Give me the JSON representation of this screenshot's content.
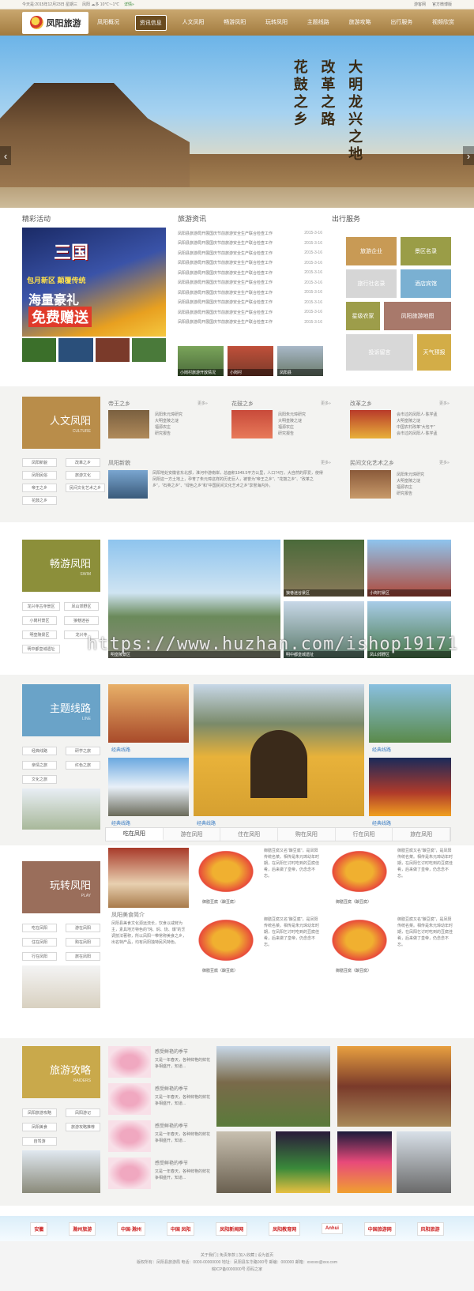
{
  "topbar": {
    "date": "今天是:2015年12月23日 星期三",
    "weather": "凤阳 ☁多 10℃~-1℃",
    "detail": "详情»",
    "links": [
      "游客网",
      "官方微博版"
    ]
  },
  "brand": {
    "logo_text": "凤阳旅游"
  },
  "nav": [
    "凤阳概况",
    "资讯信息",
    "人文凤阳",
    "畅游凤阳",
    "玩转凤阳",
    "主题线路",
    "旅游攻略",
    "出行服务",
    "视频欣赏"
  ],
  "banner": {
    "poem": [
      "大明龙兴之地",
      "改革之路",
      "花鼓之乡"
    ]
  },
  "sections": {
    "activities": "精彩活动",
    "news": "旅游资讯",
    "services": "出行服务"
  },
  "promo": {
    "game": "三国",
    "line1": "包月新区 颠覆传统",
    "line2": "海量豪礼",
    "line3": "免费赠送"
  },
  "news": [
    {
      "title": "凤阳县旅游局开展国庆节前旅游安全生产联合检查工作",
      "date": "2015-3-16"
    },
    {
      "title": "凤阳县旅游局开展国庆节前旅游安全生产联合检查工作",
      "date": "2015-3-16"
    },
    {
      "title": "凤阳县旅游局开展国庆节前旅游安全生产联合检查工作",
      "date": "2015-3-16"
    },
    {
      "title": "凤阳县旅游局开展国庆节前旅游安全生产联合检查工作",
      "date": "2015-3-16"
    },
    {
      "title": "凤阳县旅游局开展国庆节前旅游安全生产联合检查工作",
      "date": "2015-3-16"
    },
    {
      "title": "凤阳县旅游局开展国庆节前旅游安全生产联合检查工作",
      "date": "2015-3-16"
    },
    {
      "title": "凤阳县旅游局开展国庆节前旅游安全生产联合检查工作",
      "date": "2015-3-16"
    },
    {
      "title": "凤阳县旅游局开展国庆节前旅游安全生产联合检查工作",
      "date": "2015-3-16"
    },
    {
      "title": "凤阳县旅游局开展国庆节前旅游安全生产联合检查工作",
      "date": "2015-3-16"
    },
    {
      "title": "凤阳县旅游局开展国庆节前旅游安全生产联合检查工作",
      "date": "2015-3-16"
    }
  ],
  "news_thumbs": [
    "小岗村旅游开放情况",
    "小岗村",
    "凤阳县"
  ],
  "services": [
    "旅游企业",
    "景区名录",
    "旅行社名录",
    "酒店宾馆",
    "星级农家",
    "凤阳旅游地图",
    "投诉留言",
    "天气预报"
  ],
  "culture": {
    "tag": "人文凤阳",
    "tag_en": "CULTURE",
    "subs": [
      "凤阳新貌",
      "改革之乡",
      "凤阳民俗",
      "旅游文化",
      "帝王之乡",
      "花鼓之乡",
      "凤阳美食",
      "民间文化艺术之乡",
      "花鼓之乡"
    ],
    "cards": [
      {
        "title": "帝王之乡",
        "lines": [
          "凤阳朱元璋研究",
          "大明皇陵之谜",
          "福源农庄",
          "研究报告"
        ]
      },
      {
        "title": "花鼓之乡",
        "lines": [
          "凤阳朱元璋研究",
          "大明皇陵之谜",
          "福源农庄",
          "研究报告"
        ]
      },
      {
        "title": "改革之乡",
        "lines": [
          "会市过的凤阳人·陈学孟",
          "大明皇陵之谜",
          "中国农村改革\"大包干\"",
          "会市过的凤阳人·陈学孟"
        ]
      }
    ],
    "xm_title": "凤阳新貌",
    "xm_text": "凤阳地处安徽省东北部，淮河中游南岸，总面积1949.5平方公里，人口74万。大自然的厚爱，使得凤阳这一方土地上，孕育了朱元璋这样的历史巨人，被誉为\"帝王之乡\"、\"花鼓之乡\"、\"改革之乡\"，\"石英之乡\"、\"绿色之乡\"和\"中国民间文化艺术之乡\"享誉海内外。",
    "art_title": "民间文化艺术之乡",
    "art_lines": [
      "凤阳朱元璋研究",
      "大明皇陵之谜",
      "福源农庄",
      "研究报告"
    ],
    "more": "更多»"
  },
  "tour": {
    "tag": "畅游凤阳",
    "tag_en": "SWIM",
    "subs": [
      "龙兴寺古寺景区",
      "凤山郊野区",
      "小岗村景区",
      "明皇陵景区",
      "明中都皇城遗址",
      "狼巷迷谷",
      "龙兴寺"
    ],
    "caps": [
      "明皇陵景区",
      "狼巷迷谷景区",
      "小岗村景区",
      "明中都皇城遗址",
      "凤山郊野区"
    ]
  },
  "routes": {
    "tag": "主题线路",
    "tag_en": "LINE",
    "subs": [
      "经典线路",
      "研学之旅",
      "亲情之旅",
      "红色之旅",
      "文化之旅"
    ],
    "caps": [
      "经典线路",
      "经典线路",
      "经典线路",
      "经典线路",
      "经典线路"
    ]
  },
  "play": {
    "tag": "玩转凤阳",
    "tag_en": "PLAY",
    "subs": [
      "吃在凤阳",
      "游在凤阳",
      "住在凤阳",
      "购在凤阳",
      "行在凤阳",
      "旅在凤阳"
    ],
    "tabs": [
      "吃在凤阳",
      "游在凤阳",
      "住在凤阳",
      "购在凤阳",
      "行在凤阳",
      "旅在凤阳"
    ],
    "intro_title": "凤阳美食简介",
    "intro_text": "凤阳县美食文化源远流长，饮食以咸鲜为主，素具地方特色的\"炖、焖、烧、爆\"的烹调技法著称，所以凤阳一带常称美食之乡，出名特产品，均有凤阳独特民风特色。",
    "dish": "御膳豆腐（酿豆腐）",
    "dish_text": "御膳豆腐又名\"酿豆腐\"，是凤阳传统名菜。相传是朱元璋幼年时期，在凤阳乞讨时吃到的豆腐佳肴，后来做了皇帝，仍念念不忘。"
  },
  "guide": {
    "tag": "旅游攻略",
    "tag_en": "RAIDERS",
    "subs": [
      "凤阳旅游攻略",
      "凤阳游记",
      "凤阳美食",
      "旅游攻略推荐",
      "自驾游"
    ],
    "items": [
      {
        "title": "感受鲜艳的季节",
        "text": "又是一年春天，各种鲜艳的鲜花争相盛开，知道..."
      },
      {
        "title": "感受鲜艳的季节",
        "text": "又是一年春天，各种鲜艳的鲜花争相盛开，知道..."
      },
      {
        "title": "感受鲜艳的季节",
        "text": "又是一年春天，各种鲜艳的鲜花争相盛开，知道..."
      },
      {
        "title": "感受鲜艳的季节",
        "text": "又是一年春天，各种鲜艳的鲜花争相盛开，知道..."
      }
    ]
  },
  "partners": [
    "安徽",
    "滁州旅游",
    "中国·滁州",
    "中国 凤阳",
    "凤阳新闻网",
    "凤阳教育网",
    "Anhui",
    "中国旅游网",
    "风阳旅游"
  ],
  "footer": {
    "links": "关于我们 | 免责条款 | 加入收藏 | 设为首页",
    "copy": "版权所有：凤阳县旅游局 电话：0000-00000000 地址：凤阳县东华路000号 邮编：000000 邮箱：xxxxxx@xxx.com",
    "icp": "皖ICP备0000000号 原码之家"
  },
  "watermark": "https://www.huzhan.com/ishop19171",
  "colors": {
    "nav": "#b48c4e",
    "culture": "#b98d4a",
    "tour": "#8c8f3a",
    "routes": "#6aa3c8",
    "play": "#9a6e5b",
    "guide": "#c9a94b"
  }
}
